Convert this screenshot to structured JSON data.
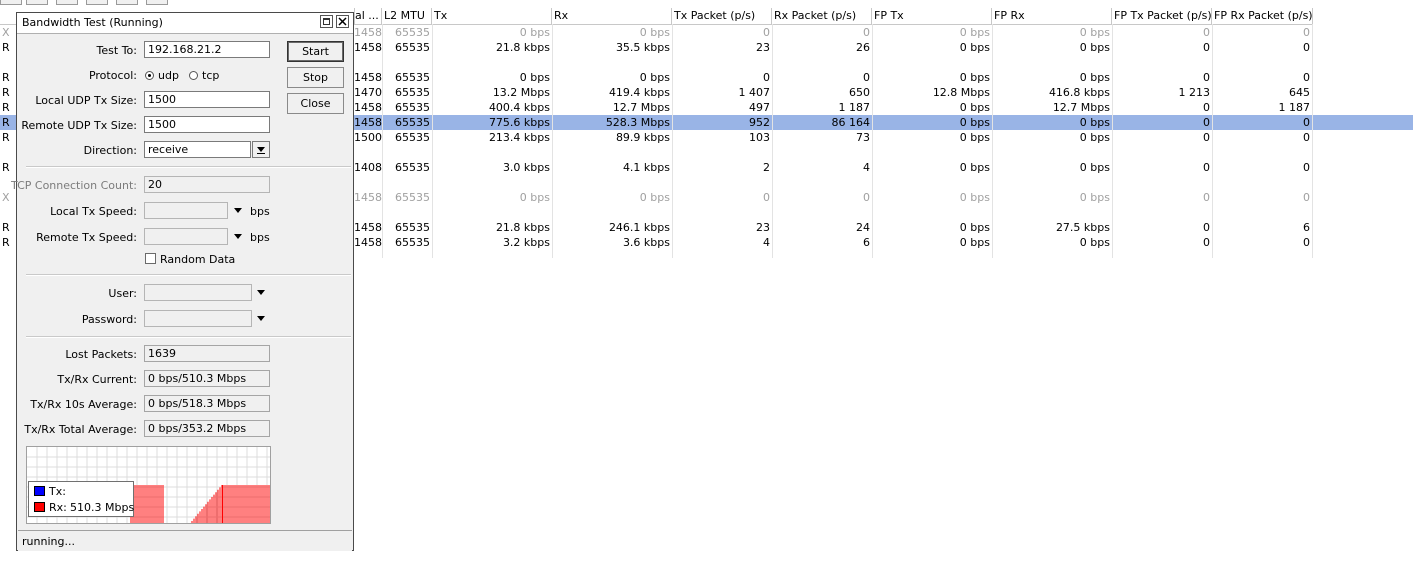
{
  "table": {
    "headers": [
      "al ...",
      "L2 MTU",
      "Tx",
      "Rx",
      "Tx Packet (p/s)",
      "Rx Packet (p/s)",
      "FP Tx",
      "FP Rx",
      "FP Tx Packet (p/s)",
      "FP Rx Packet (p/s)"
    ],
    "rows": [
      {
        "flag": "X",
        "mtu": "1458",
        "l2mtu": "65535",
        "tx": "0 bps",
        "rx": "0 bps",
        "txp": "0",
        "rxp": "0",
        "fptx": "0 bps",
        "fprx": "0 bps",
        "fptxp": "0",
        "fprxp": "0",
        "state": "disabled"
      },
      {
        "flag": "R",
        "mtu": "1458",
        "l2mtu": "65535",
        "tx": "21.8 kbps",
        "rx": "35.5 kbps",
        "txp": "23",
        "rxp": "26",
        "fptx": "0 bps",
        "fprx": "0 bps",
        "fptxp": "0",
        "fprxp": "0",
        "state": "normal"
      },
      {
        "flag": "R",
        "mtu": "1458",
        "l2mtu": "65535",
        "tx": "0 bps",
        "rx": "0 bps",
        "txp": "0",
        "rxp": "0",
        "fptx": "0 bps",
        "fprx": "0 bps",
        "fptxp": "0",
        "fprxp": "0",
        "state": "normal"
      },
      {
        "flag": "R",
        "mtu": "1470",
        "l2mtu": "65535",
        "tx": "13.2 Mbps",
        "rx": "419.4 kbps",
        "txp": "1 407",
        "rxp": "650",
        "fptx": "12.8 Mbps",
        "fprx": "416.8 kbps",
        "fptxp": "1 213",
        "fprxp": "645",
        "state": "normal"
      },
      {
        "flag": "R",
        "mtu": "1458",
        "l2mtu": "65535",
        "tx": "400.4 kbps",
        "rx": "12.7 Mbps",
        "txp": "497",
        "rxp": "1 187",
        "fptx": "0 bps",
        "fprx": "12.7 Mbps",
        "fptxp": "0",
        "fprxp": "1 187",
        "state": "normal"
      },
      {
        "flag": "R",
        "mtu": "1458",
        "l2mtu": "65535",
        "tx": "775.6 kbps",
        "rx": "528.3 Mbps",
        "txp": "952",
        "rxp": "86 164",
        "fptx": "0 bps",
        "fprx": "0 bps",
        "fptxp": "0",
        "fprxp": "0",
        "state": "selected"
      },
      {
        "flag": "R",
        "mtu": "1500",
        "l2mtu": "65535",
        "tx": "213.4 kbps",
        "rx": "89.9 kbps",
        "txp": "103",
        "rxp": "73",
        "fptx": "0 bps",
        "fprx": "0 bps",
        "fptxp": "0",
        "fprxp": "0",
        "state": "normal"
      },
      {
        "flag": "R",
        "mtu": "1408",
        "l2mtu": "65535",
        "tx": "3.0 kbps",
        "rx": "4.1 kbps",
        "txp": "2",
        "rxp": "4",
        "fptx": "0 bps",
        "fprx": "0 bps",
        "fptxp": "0",
        "fprxp": "0",
        "state": "normal"
      },
      {
        "flag": "X",
        "mtu": "1458",
        "l2mtu": "65535",
        "tx": "0 bps",
        "rx": "0 bps",
        "txp": "0",
        "rxp": "0",
        "fptx": "0 bps",
        "fprx": "0 bps",
        "fptxp": "0",
        "fprxp": "0",
        "state": "disabled"
      },
      {
        "flag": "R",
        "mtu": "1458",
        "l2mtu": "65535",
        "tx": "21.8 kbps",
        "rx": "246.1 kbps",
        "txp": "23",
        "rxp": "24",
        "fptx": "0 bps",
        "fprx": "27.5 kbps",
        "fptxp": "0",
        "fprxp": "6",
        "state": "normal"
      },
      {
        "flag": "R",
        "mtu": "1458",
        "l2mtu": "65535",
        "tx": "3.2 kbps",
        "rx": "3.6 kbps",
        "txp": "4",
        "rxp": "6",
        "fptx": "0 bps",
        "fprx": "0 bps",
        "fptxp": "0",
        "fprxp": "0",
        "state": "normal"
      }
    ]
  },
  "dialog": {
    "title": "Bandwidth Test (Running)",
    "labels": {
      "test_to": "Test To:",
      "protocol": "Protocol:",
      "local_udp_tx_size": "Local UDP Tx Size:",
      "remote_udp_tx_size": "Remote UDP Tx Size:",
      "direction": "Direction:",
      "tcp_connection_count": "TCP Connection Count:",
      "local_tx_speed": "Local Tx Speed:",
      "remote_tx_speed": "Remote Tx Speed:",
      "random_data": "Random Data",
      "user": "User:",
      "password": "Password:",
      "lost_packets": "Lost Packets:",
      "txrx_current": "Tx/Rx Current:",
      "txrx_10s_average": "Tx/Rx 10s Average:",
      "txrx_total_average": "Tx/Rx Total Average:",
      "bps": "bps"
    },
    "values": {
      "test_to": "192.168.21.2",
      "protocol_udp": "udp",
      "protocol_tcp": "tcp",
      "protocol_selected": "udp",
      "local_udp_tx_size": "1500",
      "remote_udp_tx_size": "1500",
      "direction": "receive",
      "tcp_connection_count": "20",
      "local_tx_speed": "",
      "remote_tx_speed": "",
      "random_data_checked": false,
      "user": "",
      "password": "",
      "lost_packets": "1639",
      "txrx_current": "0 bps/510.3 Mbps",
      "txrx_10s_average": "0 bps/518.3 Mbps",
      "txrx_total_average": "0 bps/353.2 Mbps"
    },
    "buttons": {
      "start": "Start",
      "stop": "Stop",
      "close": "Close"
    },
    "legend": {
      "tx_label": "Tx:",
      "rx_label": "Rx:",
      "rx_value": "510.3 Mbps",
      "tx_color": "#0000ff",
      "rx_color": "#ff0000"
    },
    "status": "running..."
  }
}
